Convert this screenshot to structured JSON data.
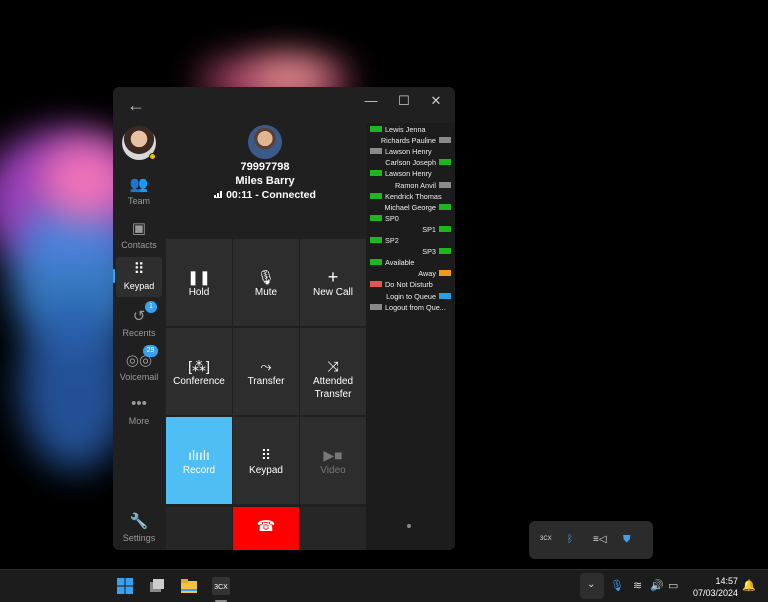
{
  "window": {
    "back_icon": "arrow-left-icon",
    "minimize": "—",
    "maximize": "☐",
    "close": "✕"
  },
  "sidebar": {
    "items": [
      {
        "label": "Team",
        "icon": "team-icon"
      },
      {
        "label": "Contacts",
        "icon": "contacts-icon"
      },
      {
        "label": "Keypad",
        "icon": "keypad-icon"
      },
      {
        "label": "Recents",
        "icon": "recents-icon",
        "badge": "1"
      },
      {
        "label": "Voicemail",
        "icon": "voicemail-icon",
        "badge": "29"
      },
      {
        "label": "More",
        "icon": "more-icon"
      },
      {
        "label": "Settings",
        "icon": "settings-icon"
      }
    ]
  },
  "call": {
    "number": "79997798",
    "name": "Miles Barry",
    "status": "00:11 - Connected"
  },
  "actions": {
    "hold": "Hold",
    "mute": "Mute",
    "new_call": "New Call",
    "conference": "Conference",
    "transfer": "Transfer",
    "attended_transfer": "Attended Transfer",
    "record": "Record",
    "keypad": "Keypad",
    "video": "Video"
  },
  "blf": [
    {
      "label": "Lewis Jenna",
      "align": "left",
      "color": "#1fb51f"
    },
    {
      "label": "Richards Pauline",
      "align": "right",
      "color": "#8a8a8a"
    },
    {
      "label": "Lawson Henry",
      "align": "left",
      "color": "#8a8a8a"
    },
    {
      "label": "Carlson Joseph",
      "align": "right",
      "color": "#1fb51f"
    },
    {
      "label": "Lawson Henry",
      "align": "left",
      "color": "#1fb51f"
    },
    {
      "label": "Ramon Anvil",
      "align": "right",
      "color": "#8a8a8a"
    },
    {
      "label": "Kendrick Thomas",
      "align": "left",
      "color": "#1fb51f"
    },
    {
      "label": "Michael George",
      "align": "right",
      "color": "#1fb51f"
    },
    {
      "label": "SP0",
      "align": "left",
      "color": "#1fb51f"
    },
    {
      "label": "SP1",
      "align": "right",
      "color": "#1fb51f"
    },
    {
      "label": "SP2",
      "align": "left",
      "color": "#1fb51f"
    },
    {
      "label": "SP3",
      "align": "right",
      "color": "#1fb51f"
    },
    {
      "label": "Available",
      "align": "left",
      "color": "#1fb51f"
    },
    {
      "label": "Away",
      "align": "right",
      "color": "#f09a1a"
    },
    {
      "label": "Do Not Disturb",
      "align": "left",
      "color": "#e0574f"
    },
    {
      "label": "Login to Queue",
      "align": "right",
      "color": "#2b9fe0"
    },
    {
      "label": "Logout from Que...",
      "align": "left",
      "color": "#8a8a8a"
    }
  ],
  "tray": {
    "items": [
      "3CX",
      "bluetooth",
      "cast",
      "defender"
    ]
  },
  "taskbar": {
    "time": "14:57",
    "date": "07/03/2024"
  },
  "colors": {
    "accent": "#4fbef4",
    "hangup": "#ff0000",
    "window_bg": "#202020"
  }
}
